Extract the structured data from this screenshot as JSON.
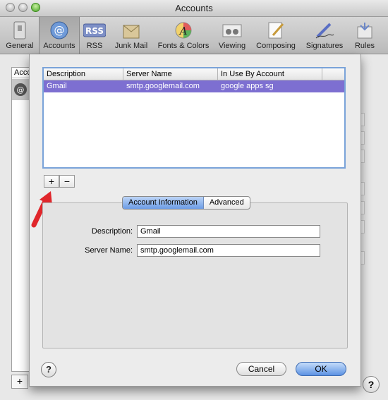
{
  "window": {
    "title": "Accounts"
  },
  "toolbar": {
    "items": [
      {
        "label": "General",
        "icon": "general-switch-icon"
      },
      {
        "label": "Accounts",
        "icon": "at-sign-icon",
        "active": true
      },
      {
        "label": "RSS",
        "icon": "rss-icon"
      },
      {
        "label": "Junk Mail",
        "icon": "junk-mail-icon"
      },
      {
        "label": "Fonts & Colors",
        "icon": "fonts-colors-icon"
      },
      {
        "label": "Viewing",
        "icon": "viewing-icon"
      },
      {
        "label": "Composing",
        "icon": "composing-icon"
      },
      {
        "label": "Signatures",
        "icon": "signatures-icon"
      },
      {
        "label": "Rules",
        "icon": "rules-icon"
      }
    ]
  },
  "background": {
    "accounts_header": "Accou",
    "add_label": "+",
    "help_label": "?"
  },
  "smtp_sheet": {
    "columns": [
      "Description",
      "Server Name",
      "In Use By Account"
    ],
    "rows": [
      {
        "description": "Gmail",
        "server": "smtp.googlemail.com",
        "account": "google apps sg"
      }
    ],
    "add_label": "+",
    "remove_label": "−",
    "tabs": {
      "account_information": "Account Information",
      "advanced": "Advanced",
      "selected": "Account Information"
    },
    "fields": {
      "description_label": "Description:",
      "description_value": "Gmail",
      "server_label": "Server Name:",
      "server_value": "smtp.googlemail.com"
    },
    "help_label": "?",
    "cancel_label": "Cancel",
    "ok_label": "OK"
  },
  "colors": {
    "selection": "#7d6fd1",
    "table_focus": "#7aa3d9",
    "arrow": "#e0262b"
  }
}
